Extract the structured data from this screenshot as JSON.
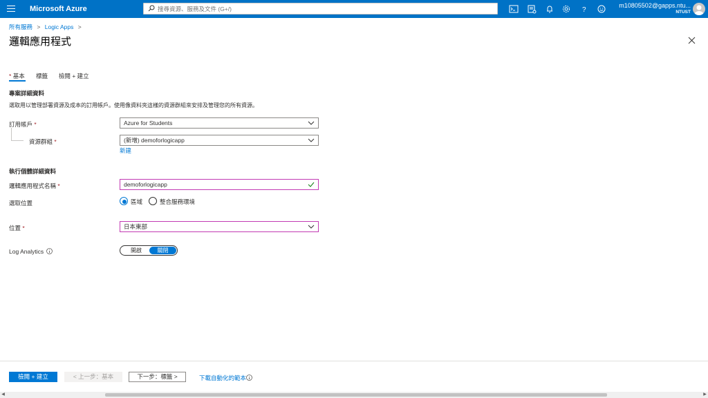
{
  "topbar": {
    "brand": "Microsoft Azure",
    "search_placeholder": "搜尋資源、服務及文件 (G+/)",
    "account_email": "m10805502@gapps.ntu...",
    "account_org": "NTUST",
    "icons": [
      "cloud-shell-icon",
      "directory-filter-icon",
      "notifications-icon",
      "settings-icon",
      "help-icon",
      "feedback-icon"
    ],
    "accent_color": "#0072c6"
  },
  "breadcrumb": {
    "items": [
      "所有服務",
      "Logic Apps"
    ]
  },
  "page": {
    "title": "邏輯應用程式"
  },
  "tabs": {
    "items": [
      {
        "label": "基本",
        "required": "*",
        "active": true
      },
      {
        "label": "標籤"
      },
      {
        "label": "檢閱 + 建立"
      }
    ]
  },
  "project": {
    "title": "專案詳細資料",
    "description": "選取用以管理部署資源及成本的訂用帳戶。使用像資料夾這樣的資源群組來安排及管理您的所有資源。",
    "subscription_label": "訂用帳戶",
    "subscription_value": "Azure for Students",
    "resource_group_label": "資源群組",
    "resource_group_value": "(新增) demoforlogicapp",
    "create_new": "新建"
  },
  "instance": {
    "title": "執行個體詳細資料",
    "name_label": "邏輯應用程式名稱",
    "name_value": "demoforlogicapp",
    "select_location_label": "選取位置",
    "radio_region": "區域",
    "radio_ise": "整合服務環境",
    "location_label": "位置",
    "location_value": "日本東部",
    "log_analytics_label": "Log Analytics",
    "toggle_on": "開啟",
    "toggle_off": "關閉",
    "required_mark": "*"
  },
  "footer": {
    "review_create": "檢閱 + 建立",
    "prev": "< 上一步：基本",
    "next": "下一步：標籤 >",
    "download_template": "下載自動化的範本"
  }
}
